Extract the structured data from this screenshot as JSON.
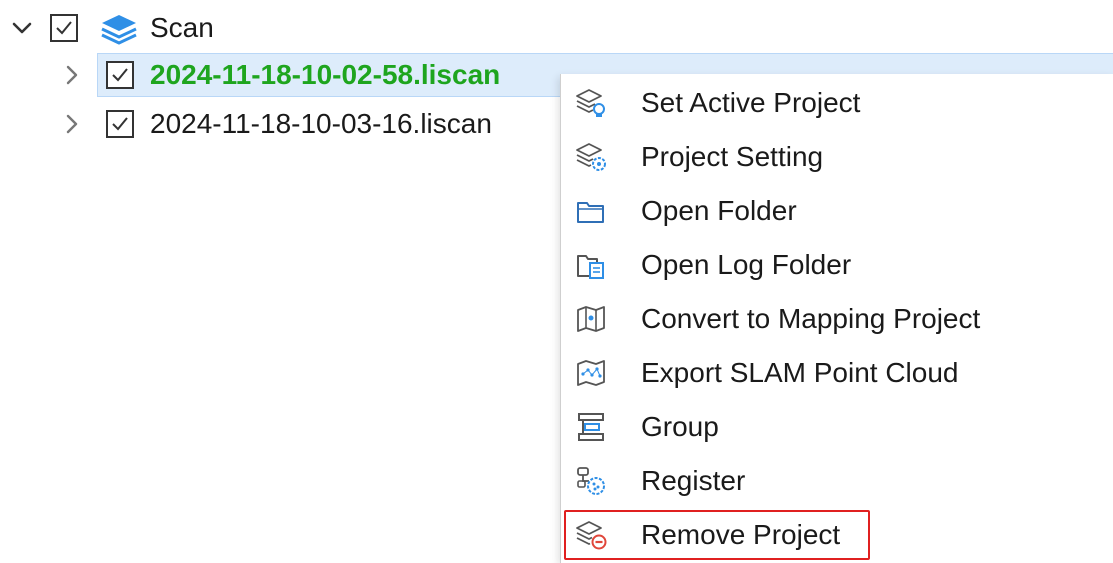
{
  "tree": {
    "root": {
      "label": "Scan",
      "checked": true,
      "expanded": true,
      "icon": "layers-icon"
    },
    "items": [
      {
        "label": "2024-11-18-10-02-58.liscan",
        "checked": true,
        "active": true,
        "selected": true
      },
      {
        "label": "2024-11-18-10-03-16.liscan",
        "checked": true,
        "active": false,
        "selected": false
      }
    ]
  },
  "context_menu": {
    "items": [
      {
        "label": "Set Active Project",
        "icon": "set-active-project-icon"
      },
      {
        "label": "Project Setting",
        "icon": "project-setting-icon"
      },
      {
        "label": "Open Folder",
        "icon": "folder-icon"
      },
      {
        "label": "Open Log Folder",
        "icon": "log-folder-icon"
      },
      {
        "label": "Convert to Mapping Project",
        "icon": "map-icon"
      },
      {
        "label": "Export SLAM Point Cloud",
        "icon": "point-cloud-map-icon"
      },
      {
        "label": "Group",
        "icon": "group-icon"
      },
      {
        "label": "Register",
        "icon": "register-icon"
      },
      {
        "label": "Remove Project",
        "icon": "remove-project-icon",
        "highlighted": true
      }
    ]
  },
  "colors": {
    "active_project": "#1ea51e",
    "selection_bg": "#ddecfb",
    "highlight_border": "#e02020",
    "icon_blue": "#2f8fe6"
  }
}
